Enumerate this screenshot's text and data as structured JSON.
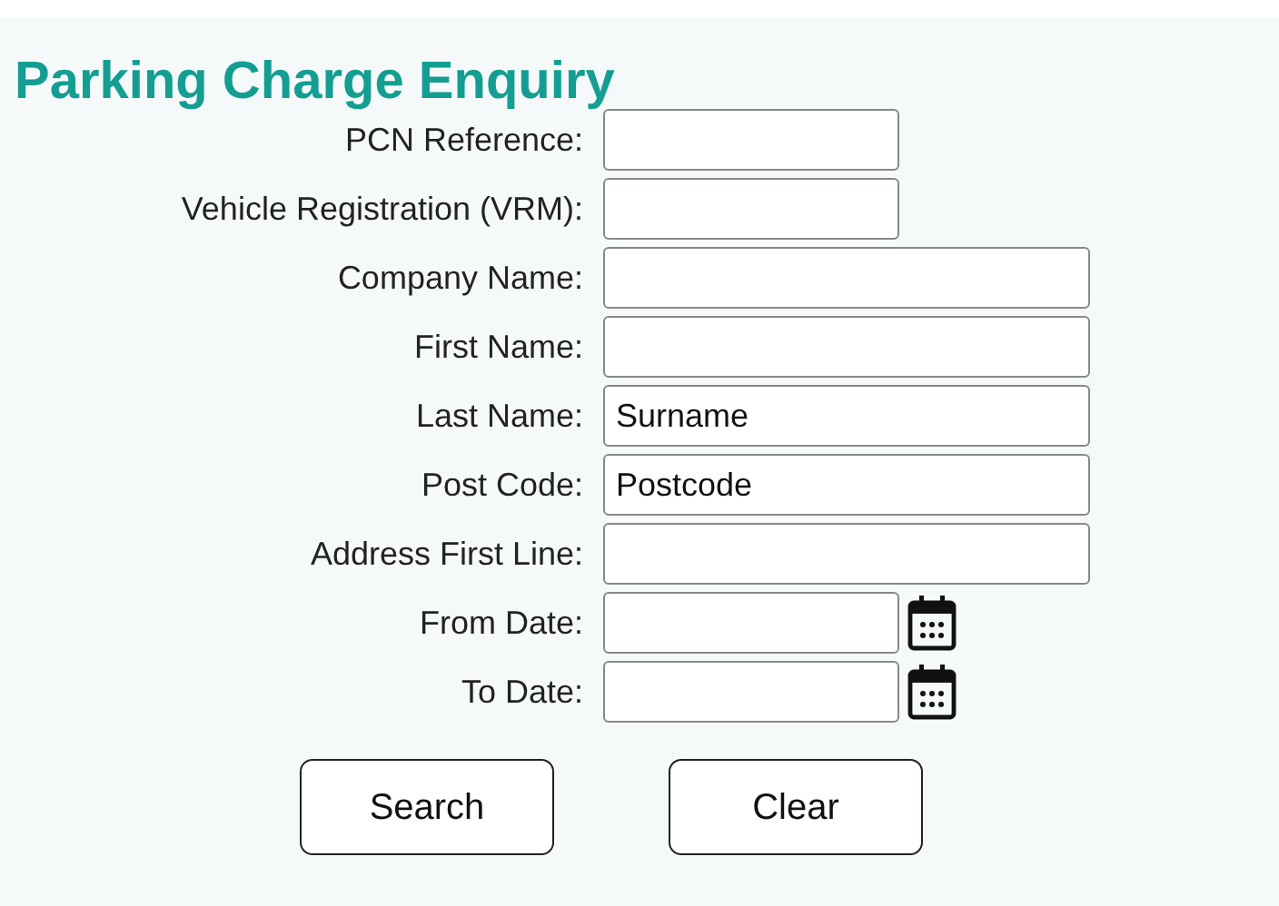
{
  "title": "Parking Charge Enquiry",
  "fields": [
    {
      "label": "PCN Reference:",
      "kind": "short"
    },
    {
      "label": "Vehicle Registration (VRM):",
      "kind": "short"
    },
    {
      "label": "Company Name:",
      "kind": "long"
    },
    {
      "label": "First Name:",
      "kind": "long"
    },
    {
      "label": "Last Name:",
      "kind": "long",
      "value": "Surname"
    },
    {
      "label": "Post Code:",
      "kind": "long",
      "value": "Postcode"
    },
    {
      "label": "Address First Line:",
      "kind": "long"
    },
    {
      "label": "From Date:",
      "kind": "date"
    },
    {
      "label": "To Date:",
      "kind": "date"
    }
  ],
  "buttons": [
    "Search",
    "Clear"
  ]
}
